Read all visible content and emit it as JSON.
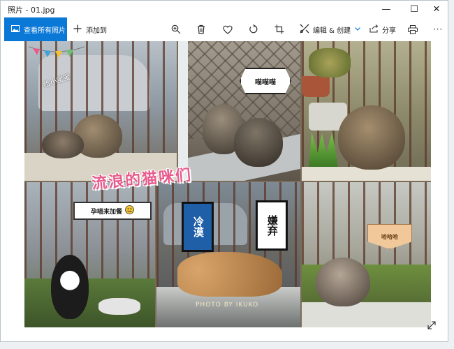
{
  "window": {
    "title": "照片 - 01.jpg",
    "controls": {
      "minimize": "—",
      "maximize": "☐",
      "close": "✕"
    }
  },
  "toolbar": {
    "view_all": "查看所有照片",
    "add_to": "添加到",
    "edit_create": "编辑 & 创建",
    "share": "分享",
    "more": "···"
  },
  "photo": {
    "title": "流浪的猫咪们",
    "stickers": {
      "top_bubble": "喵喵喵",
      "corner_text": "给小宝宝",
      "left_banner": "孕喵来加餐",
      "sign_cold": "冷漠",
      "sign_dislike": "嫌弃",
      "sign_small": "哈哈哈",
      "watermark": "PHOTO BY IKUKO"
    }
  },
  "colors": {
    "accent": "#0a78d7",
    "title_pink": "#e85a8c",
    "sign_blue": "#1f5fa8"
  }
}
